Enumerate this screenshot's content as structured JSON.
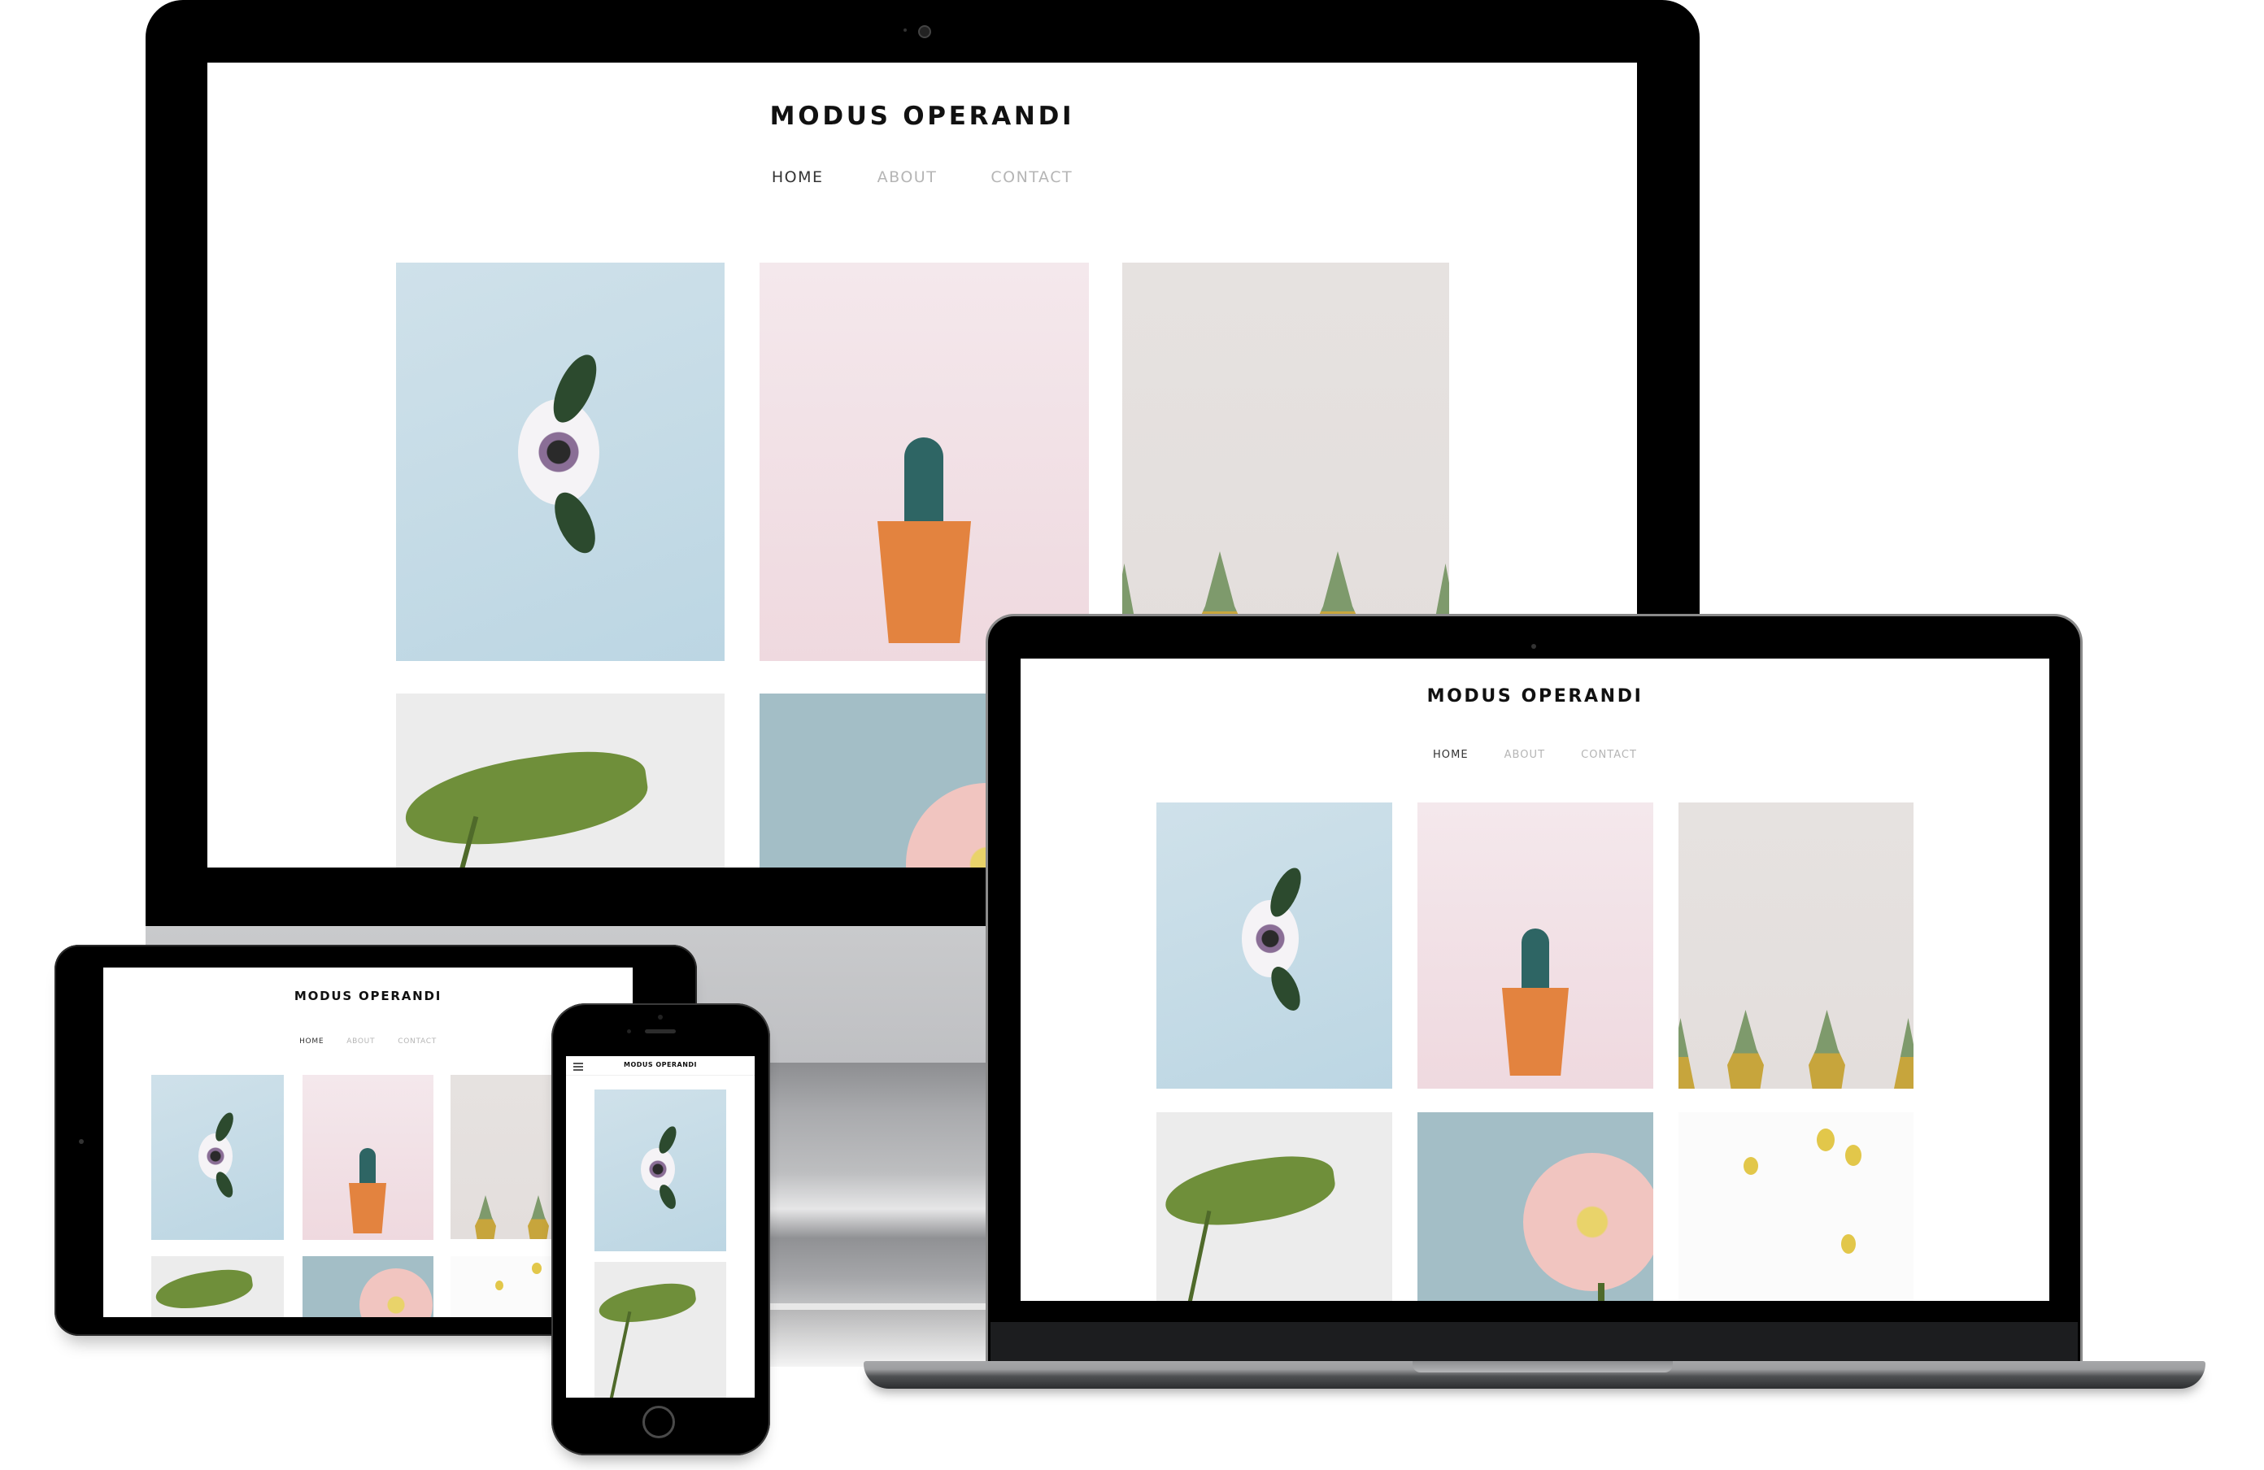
{
  "site": {
    "title": "MODUS OPERANDI",
    "nav": [
      {
        "label": "HOME",
        "active": true
      },
      {
        "label": "ABOUT",
        "active": false
      },
      {
        "label": "CONTACT",
        "active": false
      }
    ],
    "gallery": [
      {
        "name": "anemone-flower-photo",
        "subject": "white anemone with leaves on blue"
      },
      {
        "name": "cactus-photo",
        "subject": "cactus in orange pot on pink"
      },
      {
        "name": "pineapples-photo",
        "subject": "row of pineapples on grey"
      },
      {
        "name": "monstera-leaf-photo",
        "subject": "monstera leaf in glass vase"
      },
      {
        "name": "gerbera-photo",
        "subject": "pink gerbera on blue"
      },
      {
        "name": "billy-buttons-photo",
        "subject": "yellow billy buttons on white"
      }
    ],
    "menu_icon": "hamburger-icon"
  },
  "devices": [
    {
      "name": "imac",
      "label": "Desktop"
    },
    {
      "name": "laptop",
      "label": "Laptop"
    },
    {
      "name": "tablet",
      "label": "Tablet"
    },
    {
      "name": "phone",
      "label": "Phone"
    }
  ],
  "colors": {
    "title": "#111111",
    "nav_active": "#333333",
    "nav_inactive": "#b5b5b5",
    "bezel": "#000000"
  }
}
